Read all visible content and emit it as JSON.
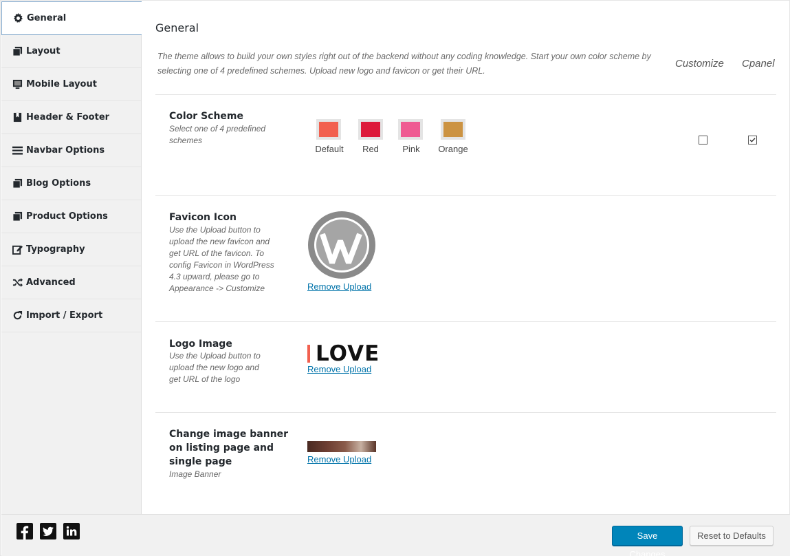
{
  "sidebar": {
    "items": [
      {
        "label": "General",
        "icon": "gear-icon"
      },
      {
        "label": "Layout",
        "icon": "copy-icon"
      },
      {
        "label": "Mobile Layout",
        "icon": "desktop-icon"
      },
      {
        "label": "Header & Footer",
        "icon": "book-icon"
      },
      {
        "label": "Navbar Options",
        "icon": "bars-icon"
      },
      {
        "label": "Blog Options",
        "icon": "copy-icon"
      },
      {
        "label": "Product Options",
        "icon": "copy-icon"
      },
      {
        "label": "Typography",
        "icon": "edit-icon"
      },
      {
        "label": "Advanced",
        "icon": "random-icon"
      },
      {
        "label": "Import / Export",
        "icon": "refresh-icon"
      }
    ]
  },
  "main": {
    "title": "General",
    "intro": "The theme allows to build your own styles right out of the backend without any coding knowledge. Start your own color scheme by selecting one of 4 predefined schemes. Upload new logo and favicon or get their URL.",
    "columns": {
      "customize": "Customize",
      "cpanel": "Cpanel"
    },
    "color_scheme": {
      "title": "Color Scheme",
      "desc_line1": "Select one of 4 predefined",
      "desc_line2": "schemes",
      "swatches": [
        {
          "label": "Default",
          "color": "#f2604f"
        },
        {
          "label": "Red",
          "color": "#dd1a3a"
        },
        {
          "label": "Pink",
          "color": "#ef5b92"
        },
        {
          "label": "Orange",
          "color": "#cc9342"
        }
      ],
      "customize_checked": false,
      "cpanel_checked": true
    },
    "favicon": {
      "title": "Favicon Icon",
      "desc_lines": [
        "Use the Upload button to",
        "upload the new favicon and",
        "get URL of the favicon. To",
        "config Favicon in WordPress",
        "4.3 upward, please go to",
        "Appearance -> Customize"
      ],
      "remove_label": "Remove Upload"
    },
    "logo": {
      "title": "Logo Image",
      "desc_lines": [
        "Use the Upload button to",
        "upload the new logo and",
        "get URL of the logo"
      ],
      "logo_text": "LOVE",
      "remove_label": "Remove Upload"
    },
    "banner": {
      "title_lines": [
        "Change image banner",
        "on listing page and",
        "single page"
      ],
      "desc": "Image Banner",
      "remove_label": "Remove Upload"
    }
  },
  "footer": {
    "social": [
      "facebook-icon",
      "twitter-icon",
      "linkedin-icon"
    ],
    "save_label": "Save Changes",
    "reset_label": "Reset to Defaults"
  },
  "colors": {
    "accent": "#0085ba",
    "link": "#0073aa"
  }
}
